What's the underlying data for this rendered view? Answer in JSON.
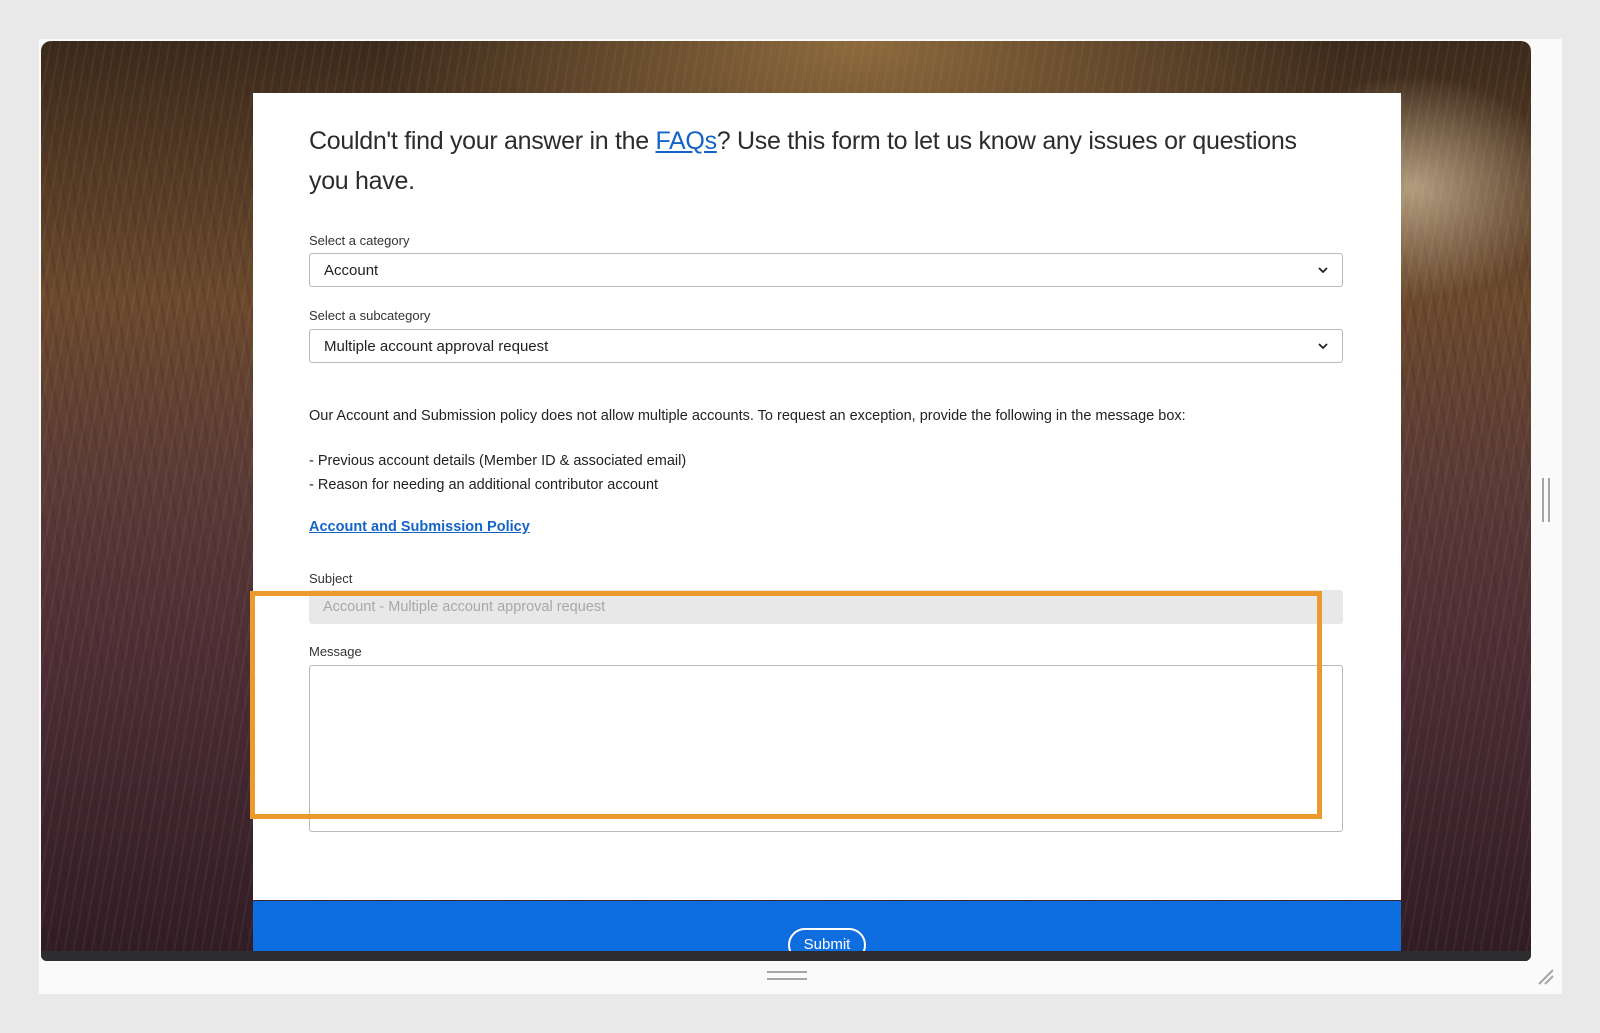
{
  "form": {
    "intro_before": "Couldn't find your answer in the ",
    "faq_link": "FAQs",
    "intro_after": "? Use this form to let us know any issues or questions you have.",
    "category": {
      "label": "Select a category",
      "value": "Account",
      "icon": "chevron-down-icon"
    },
    "subcategory": {
      "label": "Select a subcategory",
      "value": "Multiple account approval request",
      "icon": "chevron-down-icon"
    },
    "policy": {
      "description": "Our Account and Submission policy does not allow multiple accounts. To request an exception, provide the following in the message box:",
      "bullets": [
        "- Previous account details (Member ID & associated email)",
        "- Reason for needing an additional contributor account"
      ],
      "link": "Account and Submission Policy"
    },
    "subject": {
      "label": "Subject",
      "value": "Account - Multiple account approval request"
    },
    "message": {
      "label": "Message",
      "value": ""
    },
    "submit_label": "Submit"
  },
  "colors": {
    "accent": "#0e6ee0",
    "link": "#1463c6",
    "highlight": "#ec9a2e"
  }
}
